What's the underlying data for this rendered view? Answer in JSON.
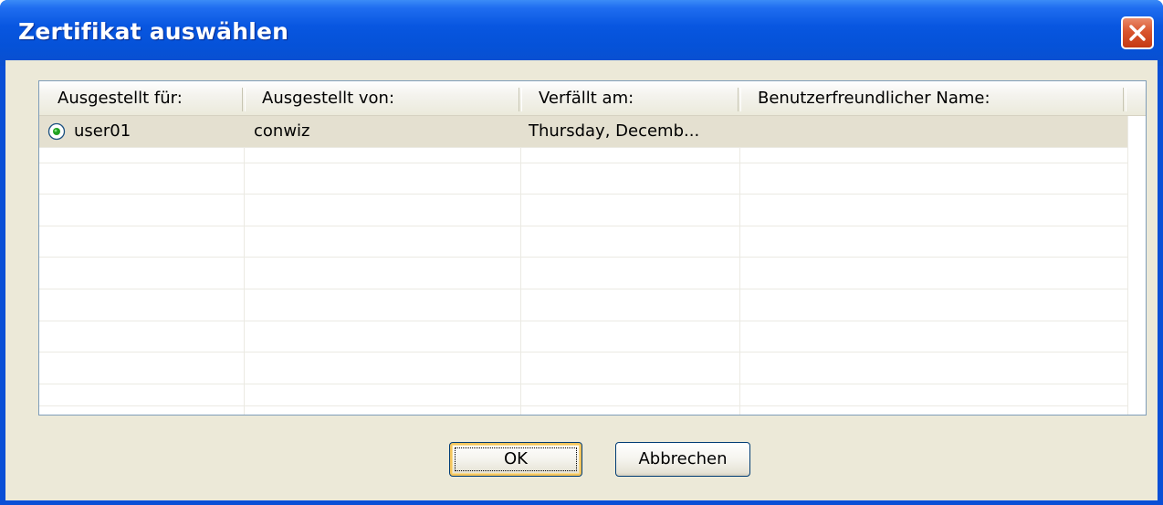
{
  "window": {
    "title": "Zertifikat auswählen"
  },
  "table": {
    "columns": [
      "Ausgestellt für:",
      "Ausgestellt von:",
      "Verfällt am:",
      "Benutzerfreundlicher Name:"
    ],
    "rows": [
      {
        "issued_to": "user01",
        "issued_by": "conwiz",
        "expires": "Thursday, Decemb...",
        "friendly_name": "",
        "selected": true
      }
    ]
  },
  "buttons": {
    "ok_label": "OK",
    "cancel_label": "Abbrechen"
  },
  "colors": {
    "titlebar": "#0552d8",
    "client_bg": "#ece9d8",
    "close_button": "#d9552e",
    "selected_row": "#e4e0d0",
    "radio_dot": "#21a121"
  },
  "icons": {
    "close": "close-icon",
    "radio": "radio-selected-icon"
  }
}
